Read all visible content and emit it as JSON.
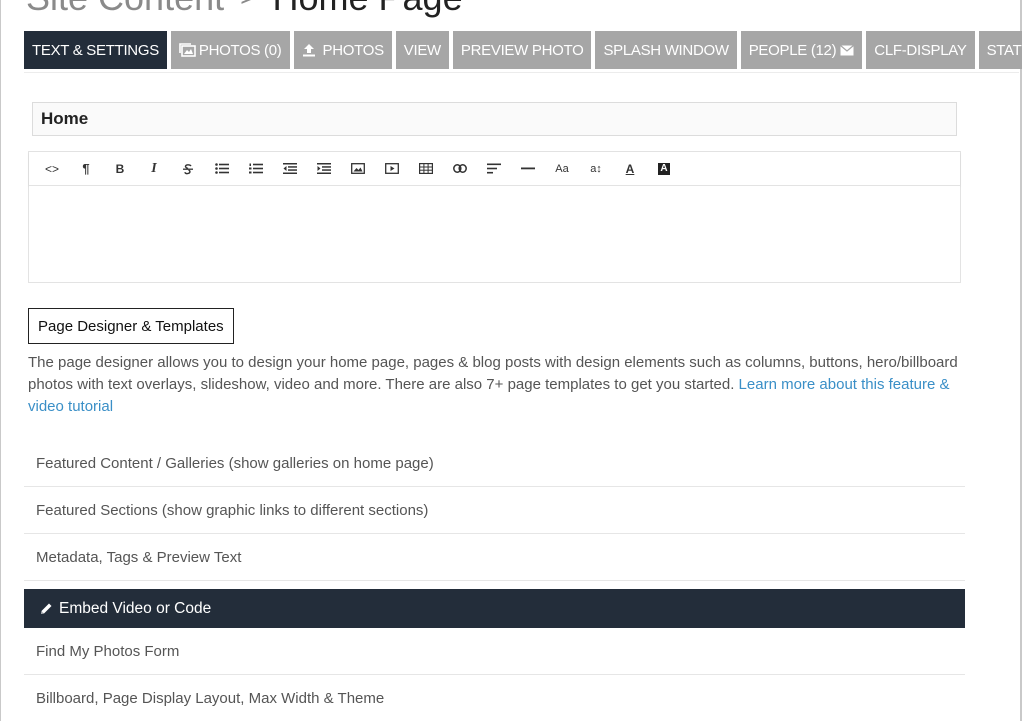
{
  "header": {
    "crumb": "Site Content",
    "separator": ">",
    "title": "Home Page"
  },
  "tabs": [
    {
      "label": "TEXT & SETTINGS",
      "icon": "",
      "active": true
    },
    {
      "label": "PHOTOS (0)",
      "icon": "photos-stack-icon"
    },
    {
      "label": "PHOTOS",
      "icon": "upload-icon"
    },
    {
      "label": "VIEW"
    },
    {
      "label": "PREVIEW PHOTO"
    },
    {
      "label": "SPLASH WINDOW"
    },
    {
      "label": "PEOPLE (12)",
      "icon_after": "envelope-icon"
    },
    {
      "label": "CLF-DISPLAY"
    },
    {
      "label": "STATS"
    }
  ],
  "title_field": {
    "value": "Home"
  },
  "editor": {
    "toolbar": [
      "code-view-icon",
      "paragraph-icon",
      "bold-icon",
      "italic-icon",
      "strikethrough-icon",
      "bulleted-list-icon",
      "numbered-list-icon",
      "outdent-icon",
      "indent-icon",
      "insert-image-icon",
      "insert-video-icon",
      "insert-table-icon",
      "insert-link-icon",
      "align-icon",
      "horizontal-rule-icon",
      "font-size-icon",
      "line-height-icon",
      "font-color-icon",
      "background-color-icon"
    ],
    "labels": {
      "code": "<>",
      "paragraph": "¶",
      "bold": "B",
      "italic": "I",
      "font_size": "Aa",
      "line_height": "a↕",
      "font_color": "A",
      "bg_color": "A"
    }
  },
  "designer_button": "Page Designer & Templates",
  "description": {
    "text": "The page designer allows you to design your home page, pages & blog posts with design elements such as columns, buttons, hero/billboard photos with text overlays, slideshow, video and more. There are also 7+ page templates to get you started. ",
    "link": "Learn more about this feature & video tutorial"
  },
  "sections": [
    {
      "label": "Featured Content / Galleries (show galleries on home page)"
    },
    {
      "label": "Featured Sections (show graphic links to different sections)"
    },
    {
      "label": "Metadata, Tags & Preview Text"
    },
    {
      "label": "Embed Video or Code",
      "active": true,
      "icon": "pencil-icon"
    },
    {
      "label": "Find My Photos Form"
    },
    {
      "label": "Billboard, Page Display Layout, Max Width & Theme"
    }
  ],
  "colors": {
    "active_dark": "#232d3a",
    "tab_gray": "#a6a6a6",
    "link_blue": "#3a8fc7"
  }
}
